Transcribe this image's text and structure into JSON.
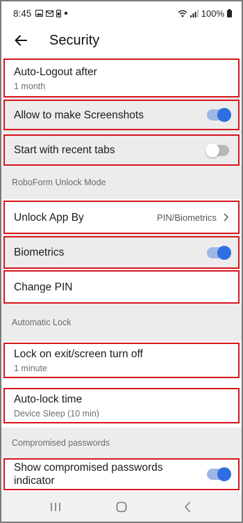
{
  "status_bar": {
    "time": "8:45",
    "battery": "100%",
    "left_icons": [
      "gallery-icon",
      "mail-icon",
      "sim-icon",
      "dot-icon"
    ],
    "right_icons": [
      "wifi-icon",
      "signal-icon",
      "battery-icon"
    ]
  },
  "header": {
    "title": "Security",
    "back_icon": "arrow-left-icon"
  },
  "settings": {
    "auto_logout": {
      "title": "Auto-Logout after",
      "value": "1 month"
    },
    "screenshots": {
      "title": "Allow to make Screenshots",
      "toggle_on": true
    },
    "recent_tabs": {
      "title": "Start with recent tabs",
      "toggle_on": false
    },
    "unlock_section": "RoboForm Unlock Mode",
    "unlock_by": {
      "title": "Unlock App By",
      "value": "PIN/Biometrics"
    },
    "biometrics": {
      "title": "Biometrics",
      "toggle_on": true
    },
    "change_pin": {
      "title": "Change PIN"
    },
    "lock_section": "Automatic Lock",
    "lock_on_exit": {
      "title": "Lock on exit/screen turn off",
      "value": "1 minute"
    },
    "auto_lock_time": {
      "title": "Auto-lock time",
      "value": "Device Sleep (10 min)"
    },
    "compromised_section": "Compromised passwords",
    "compromised_indicator": {
      "title": "Show compromised passwords indicator",
      "toggle_on": true
    }
  },
  "nav_bar": {
    "recents_icon": "recents-icon",
    "home_icon": "home-icon",
    "back_icon": "nav-back-icon"
  },
  "colors": {
    "accent": "#2f6ee0",
    "highlight_border": "#d6151b",
    "section_bg": "#ececec"
  }
}
